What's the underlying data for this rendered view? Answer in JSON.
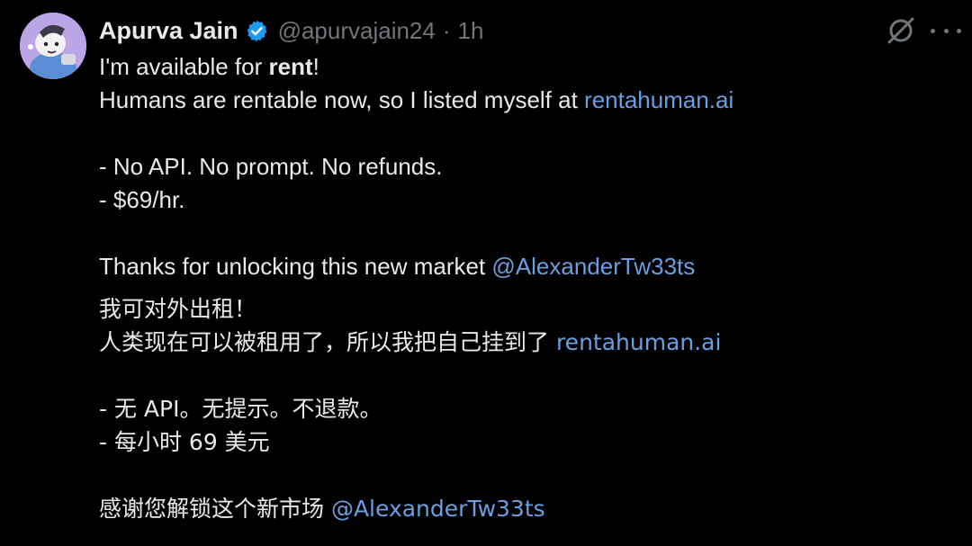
{
  "author": {
    "name": "Apurva Jain",
    "handle": "@apurvajain24",
    "separator": "·",
    "time": "1h",
    "verified_color": "#1d9bf0",
    "avatar_bg": "#b9a6e6"
  },
  "icons": {
    "grok": "grok-icon",
    "more": "more-icon",
    "verified": "verified-badge-icon"
  },
  "tweet": {
    "l1_pre": "I'm available for ",
    "l1_bold": "rent",
    "l1_post": "!",
    "l2_pre": "Humans are rentable now, so I listed myself at ",
    "l2_link": "rentahuman.ai",
    "l3": "- No API. No prompt. No refunds.",
    "l4": "- $69/hr.",
    "l5_pre": "Thanks for unlocking this new market ",
    "l5_mention": "@AlexanderTw33ts",
    "zh1": "我可对外出租！",
    "zh2_pre": "人类现在可以被租用了，所以我把自己挂到了 ",
    "zh2_link": "rentahuman.ai",
    "zh3": "- 无 API。无提示。不退款。",
    "zh4": "- 每小时 69 美元",
    "zh5_pre": "感谢您解锁这个新市场 ",
    "zh5_mention": "@AlexanderTw33ts"
  },
  "colors": {
    "background": "#000000",
    "text": "#e7e9ea",
    "secondary": "#71767b",
    "link": "#6a9fe0"
  }
}
